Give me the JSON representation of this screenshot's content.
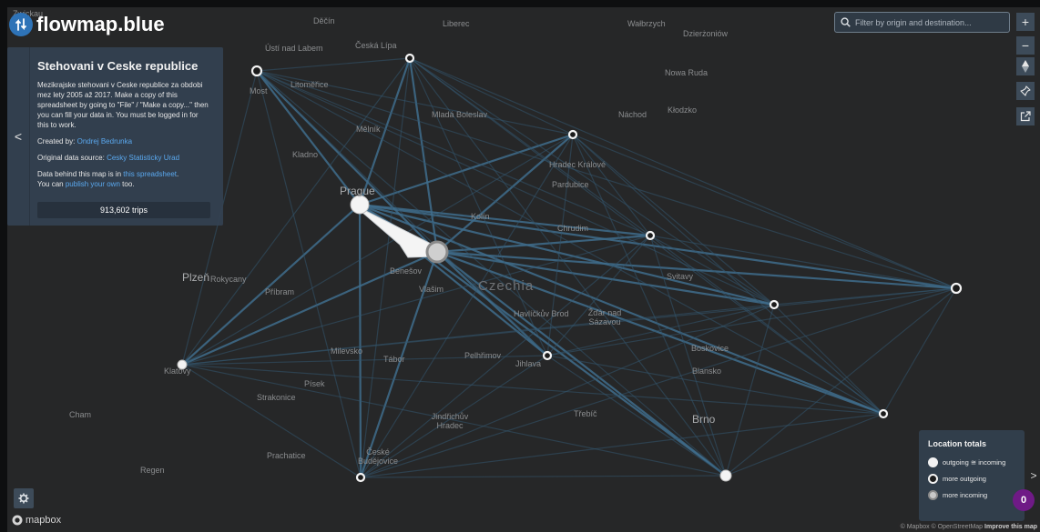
{
  "brand": {
    "name": "flowmap.blue"
  },
  "info_panel": {
    "collapse_glyph": "<",
    "title": "Stehovani v Ceske republice",
    "description": "Mezikrajske stehovani v Ceske republice za obdobi mez lety 2005 až 2017. Make a copy of this spreadsheet by going to \"File\" / \"Make a copy...\" then you can fill your data in. You must be logged in for this to work.",
    "created_by_label": "Created by:",
    "created_by_name": "Ondrej Bedrunka",
    "source_label": "Original data source:",
    "source_name": "Cesky Statisticky Urad",
    "data_text_1": "Data behind this map is in",
    "data_link": "this spreadsheet",
    "data_text_2": ".",
    "publish_text_1": "You can",
    "publish_link": "publish your own",
    "publish_text_2": "too.",
    "trips": "913,602 trips"
  },
  "search": {
    "placeholder": "Filter by origin and destination..."
  },
  "map_controls": {
    "zoom_in": "+",
    "zoom_out": "−"
  },
  "legend": {
    "title": "Location totals",
    "items": [
      "outgoing ≅ incoming",
      "more outgoing",
      "more incoming"
    ],
    "toggle_glyph": ">"
  },
  "selected_count": "0",
  "map_attribution": {
    "logo_text": "mapbox",
    "text": "© Mapbox © OpenStreetMap",
    "improve": "Improve this map"
  },
  "places": [
    {
      "name": "Děčín",
      "cls": ""
    },
    {
      "name": "Liberec",
      "cls": ""
    },
    {
      "name": "Wałbrzych",
      "cls": ""
    },
    {
      "name": "Dzierżoniów",
      "cls": ""
    },
    {
      "name": "Zwickau",
      "cls": ""
    },
    {
      "name": "Ústí nad Labem",
      "cls": ""
    },
    {
      "name": "Česká Lípa",
      "cls": ""
    },
    {
      "name": "Nowa Ruda",
      "cls": ""
    },
    {
      "name": "Most",
      "cls": ""
    },
    {
      "name": "Litoměřice",
      "cls": ""
    },
    {
      "name": "Mladá Boleslav",
      "cls": ""
    },
    {
      "name": "Náchod",
      "cls": ""
    },
    {
      "name": "Kłodzko",
      "cls": ""
    },
    {
      "name": "Mělník",
      "cls": ""
    },
    {
      "name": "Hradec Králové",
      "cls": ""
    },
    {
      "name": "Kladno",
      "cls": ""
    },
    {
      "name": "Prague",
      "cls": "big"
    },
    {
      "name": "Kolín",
      "cls": ""
    },
    {
      "name": "Pardubice",
      "cls": ""
    },
    {
      "name": "Chrudim",
      "cls": ""
    },
    {
      "name": "Benešov",
      "cls": ""
    },
    {
      "name": "Plzeň",
      "cls": "big"
    },
    {
      "name": "Rokycany",
      "cls": ""
    },
    {
      "name": "Svitavy",
      "cls": ""
    },
    {
      "name": "Příbram",
      "cls": ""
    },
    {
      "name": "Vlašim",
      "cls": ""
    },
    {
      "name": "Czechia",
      "cls": "country"
    },
    {
      "name": "Havlíčkův Brod",
      "cls": ""
    },
    {
      "name": "Žďár nad Sázavou",
      "cls": ""
    },
    {
      "name": "Boskovice",
      "cls": ""
    },
    {
      "name": "Milevsko",
      "cls": ""
    },
    {
      "name": "Tábor",
      "cls": ""
    },
    {
      "name": "Pelhřimov",
      "cls": ""
    },
    {
      "name": "Jihlava",
      "cls": ""
    },
    {
      "name": "Blansko",
      "cls": ""
    },
    {
      "name": "Klatovy",
      "cls": ""
    },
    {
      "name": "Písek",
      "cls": ""
    },
    {
      "name": "Strakonice",
      "cls": ""
    },
    {
      "name": "Cham",
      "cls": ""
    },
    {
      "name": "Jindřichův Hradec",
      "cls": ""
    },
    {
      "name": "Třebíč",
      "cls": ""
    },
    {
      "name": "Brno",
      "cls": "big"
    },
    {
      "name": "Prachatice",
      "cls": ""
    },
    {
      "name": "České Budějovice",
      "cls": ""
    },
    {
      "name": "Regen",
      "cls": ""
    }
  ]
}
